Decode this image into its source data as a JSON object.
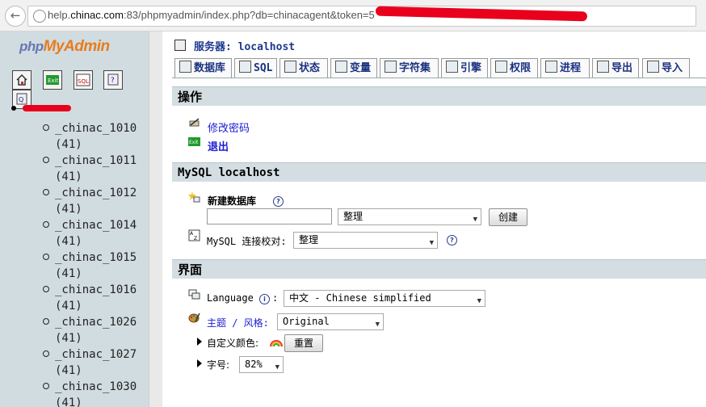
{
  "browser": {
    "url_prefix": "help.",
    "url_host": "chinac.com",
    "url_rest": ":83/phpmyadmin/index.php?db=chinacagent&token=5"
  },
  "sidebar": {
    "logo_php": "php",
    "logo_rest": "MyAdmin",
    "icons": [
      "home-icon",
      "exit-icon",
      "sql-query-icon",
      "docs-icon",
      "query-window-icon"
    ],
    "tables": [
      {
        "name": "_chinac_1010",
        "count": "(41)"
      },
      {
        "name": "_chinac_1011",
        "count": "(41)"
      },
      {
        "name": "_chinac_1012",
        "count": "(41)"
      },
      {
        "name": "_chinac_1014",
        "count": "(41)"
      },
      {
        "name": "_chinac_1015",
        "count": "(41)"
      },
      {
        "name": "_chinac_1016",
        "count": "(41)"
      },
      {
        "name": "_chinac_1026",
        "count": "(41)"
      },
      {
        "name": "_chinac_1027",
        "count": "(41)"
      },
      {
        "name": "_chinac_1030",
        "count": "(41)"
      }
    ]
  },
  "server": {
    "label": "服务器:",
    "name": "localhost"
  },
  "tabs": [
    {
      "label": "数据库"
    },
    {
      "label": "SQL"
    },
    {
      "label": "状态"
    },
    {
      "label": "变量"
    },
    {
      "label": "字符集"
    },
    {
      "label": "引擎"
    },
    {
      "label": "权限"
    },
    {
      "label": "进程"
    },
    {
      "label": "导出"
    },
    {
      "label": "导入"
    }
  ],
  "sections": {
    "ops": {
      "title": "操作",
      "change_password": "修改密码",
      "logout": "退出"
    },
    "mysql": {
      "title": "MySQL localhost",
      "create_db_label": "新建数据库",
      "collation_select": "整理",
      "create_button": "创建",
      "conn_collation_label": "MySQL 连接校对:",
      "conn_collation_value": "整理"
    },
    "ui": {
      "title": "界面",
      "language_label": "Language",
      "language_value": "中文 - Chinese simplified",
      "theme_label": "主题 / 风格:",
      "theme_value": "Original",
      "custom_color_label": "自定义颜色:",
      "reset_button": "重置",
      "font_size_label": "字号:",
      "font_size_value": "82%"
    }
  },
  "colors": {
    "sidebar_bg": "#d0dce0",
    "section_bg": "#d4dde2",
    "link": "#1b1bd3",
    "logo_orange": "#e87b1c"
  }
}
